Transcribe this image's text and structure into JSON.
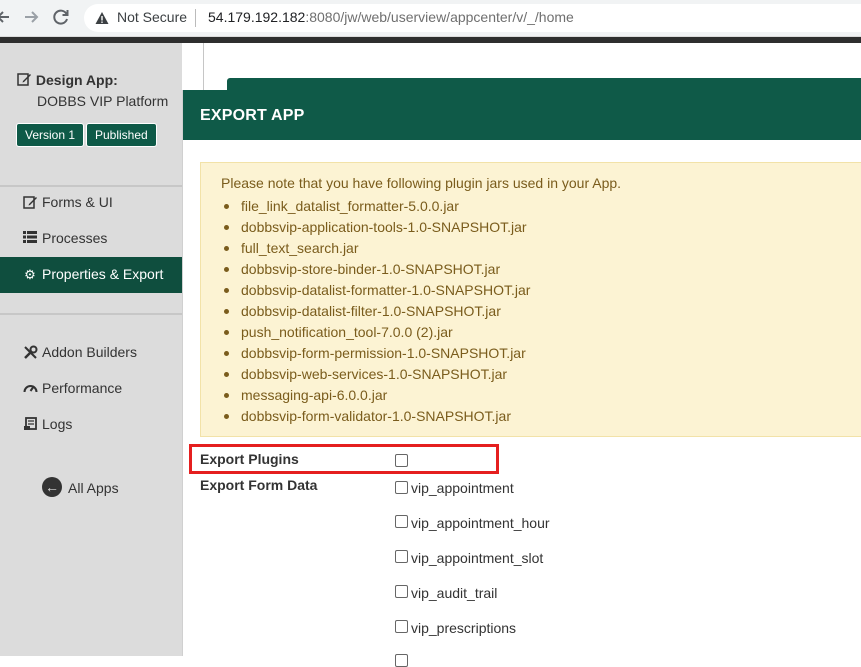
{
  "browser": {
    "not_secure": "Not Secure",
    "url_host": "54.179.192.182",
    "url_rest": ":8080/jw/web/userview/appcenter/v/_/home"
  },
  "sidebar": {
    "design_app_label": "Design App:",
    "app_name": "DOBBS VIP Platform",
    "version_badge": "Version 1",
    "published_badge": "Published",
    "items": [
      {
        "label": "Forms & UI",
        "icon": "edit-icon"
      },
      {
        "label": "Processes",
        "icon": "list-icon"
      },
      {
        "label": "Properties & Export",
        "icon": "gear-icon",
        "active": true
      },
      {
        "label": "Addon Builders",
        "icon": "tools-icon"
      },
      {
        "label": "Performance",
        "icon": "speedometer-icon"
      },
      {
        "label": "Logs",
        "icon": "scroll-icon"
      }
    ],
    "all_apps": "All Apps"
  },
  "modal": {
    "title": "EXPORT APP",
    "notice": "Please note that you have following plugin jars used in your App.",
    "plugins": [
      "file_link_datalist_formatter-5.0.0.jar",
      "dobbsvip-application-tools-1.0-SNAPSHOT.jar",
      "full_text_search.jar",
      "dobbsvip-store-binder-1.0-SNAPSHOT.jar",
      "dobbsvip-datalist-formatter-1.0-SNAPSHOT.jar",
      "dobbsvip-datalist-filter-1.0-SNAPSHOT.jar",
      "push_notification_tool-7.0.0 (2).jar",
      "dobbsvip-form-permission-1.0-SNAPSHOT.jar",
      "dobbsvip-web-services-1.0-SNAPSHOT.jar",
      "messaging-api-6.0.0.jar",
      "dobbsvip-form-validator-1.0-SNAPSHOT.jar"
    ],
    "export_plugins_label": "Export Plugins",
    "export_form_data_label": "Export Form Data",
    "form_tables": [
      "vip_appointment",
      "vip_appointment_hour",
      "vip_appointment_slot",
      "vip_audit_trail",
      "vip_prescriptions"
    ]
  },
  "colors": {
    "primary_green": "#0f5a48",
    "notice_bg": "#fcf3d3",
    "highlight_red": "#e51f1f"
  }
}
